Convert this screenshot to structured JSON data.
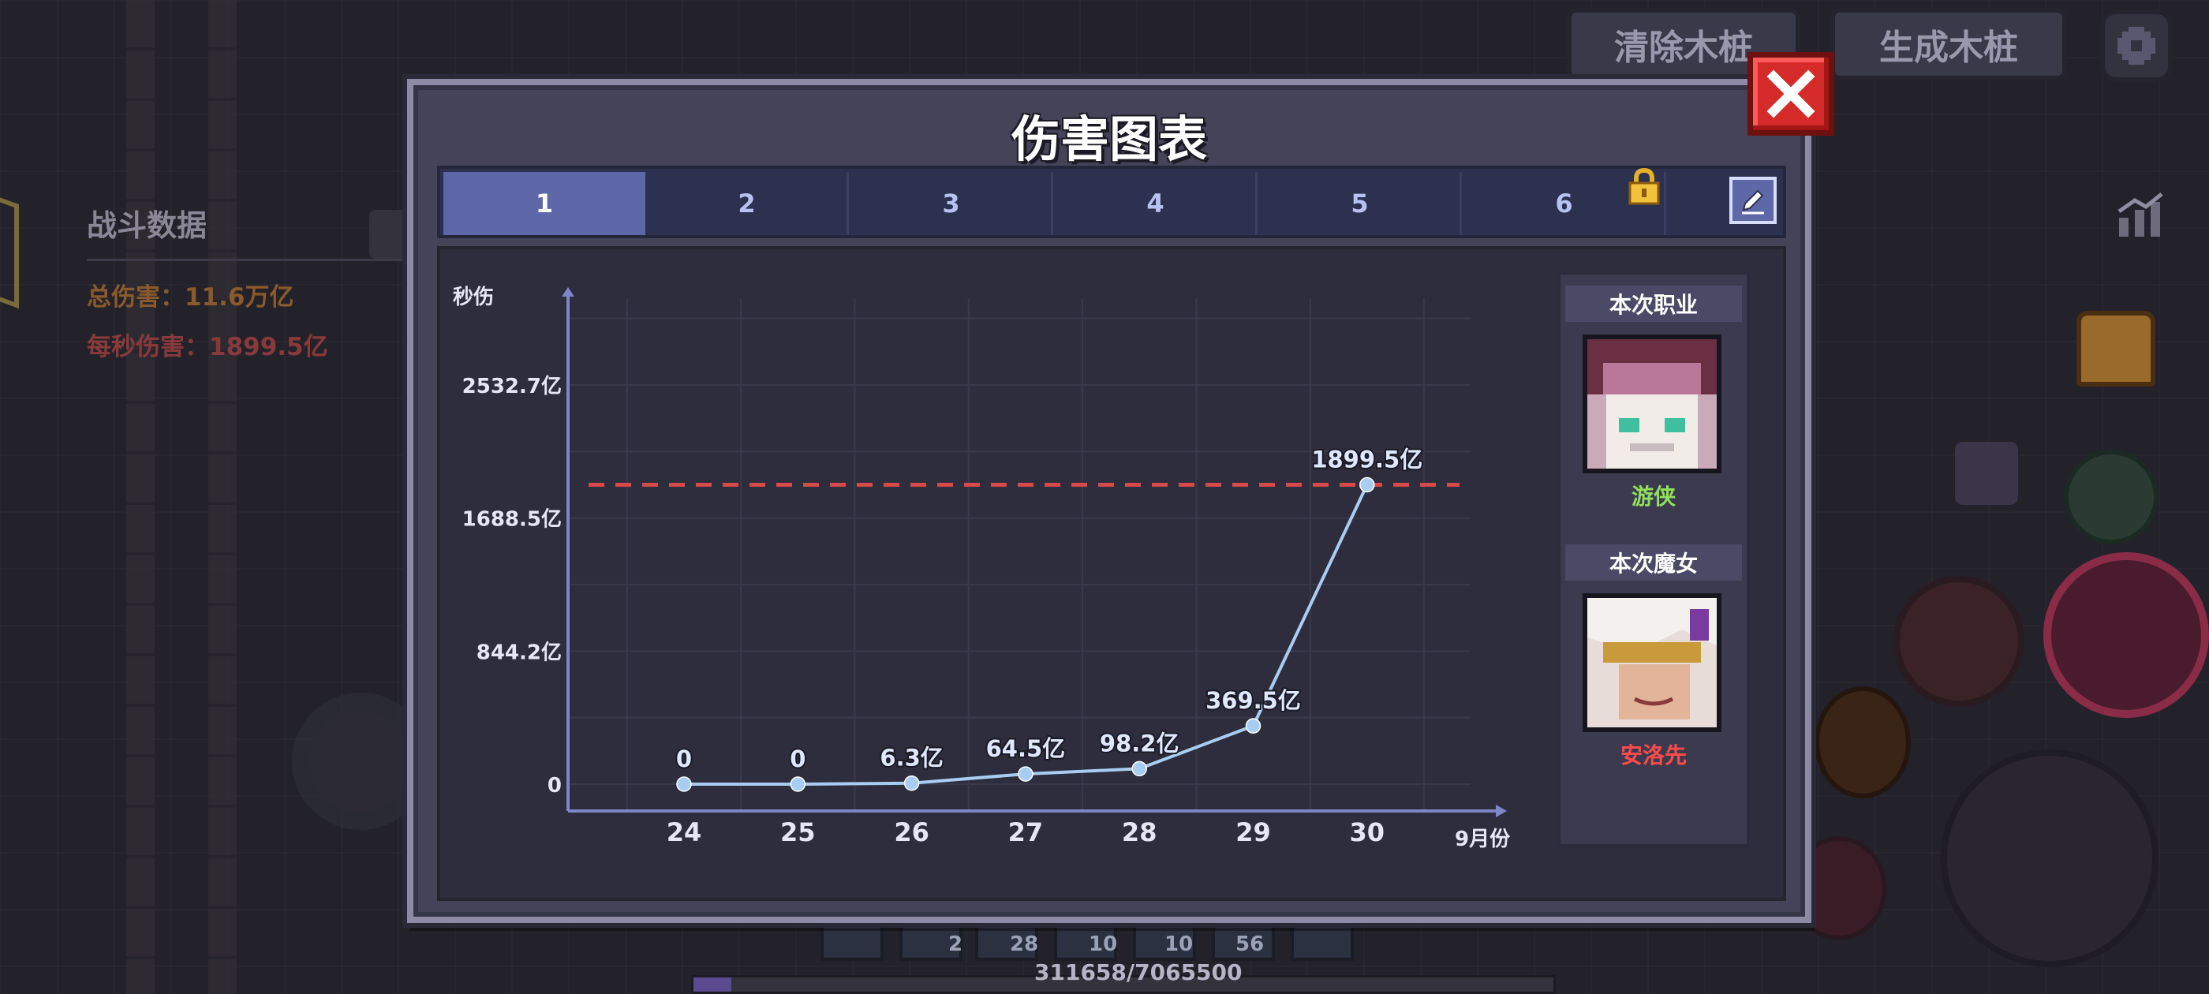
{
  "game_hud": {
    "clear_stakes_label": "清除木桩",
    "spawn_stakes_label": "生成木桩",
    "battle_data": {
      "title": "战斗数据",
      "total_damage": "总伤害：11.6万亿",
      "dps": "每秒伤害：1899.5亿"
    },
    "hotbar_counts": [
      "2",
      "28",
      "10",
      "10",
      "56"
    ],
    "exp_text": "311658/7065500"
  },
  "modal": {
    "title": "伤害图表",
    "tabs": [
      {
        "label": "1",
        "active": true
      },
      {
        "label": "2",
        "active": false
      },
      {
        "label": "3",
        "active": false
      },
      {
        "label": "4",
        "active": false
      },
      {
        "label": "5",
        "active": false
      },
      {
        "label": "6",
        "active": false,
        "locked": true
      }
    ],
    "icons": {
      "close": "close-icon",
      "lock": "lock-icon",
      "edit": "pencil-icon"
    }
  },
  "info_panel": {
    "class_header": "本次职业",
    "class_name": "游侠",
    "class_color": "#8fe05a",
    "witch_header": "本次魔女",
    "witch_name": "安洛先",
    "witch_color": "#ff4a4a"
  },
  "chart_data": {
    "type": "line",
    "ylabel": "秒伤",
    "xlabel": "9月份",
    "x": [
      24,
      25,
      26,
      27,
      28,
      29,
      30
    ],
    "values": [
      0,
      0,
      6.3,
      64.5,
      98.2,
      369.5,
      1899.5
    ],
    "point_labels": [
      "0",
      "0",
      "6.3亿",
      "64.5亿",
      "98.2亿",
      "369.5亿",
      "1899.5亿"
    ],
    "y_ticks": [
      0,
      844.2,
      1688.5,
      2532.7
    ],
    "y_tick_labels": [
      "0",
      "844.2亿",
      "1688.5亿",
      "2532.7亿"
    ],
    "ylim": [
      0,
      2532.7
    ],
    "reference_line": {
      "value": 1899.5,
      "color": "#d64a4a",
      "style": "dashed"
    },
    "line_color": "#a9cdf2",
    "grid": true
  }
}
